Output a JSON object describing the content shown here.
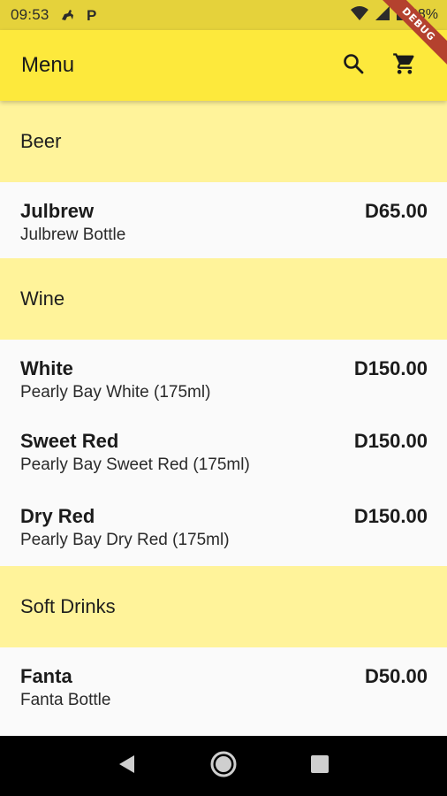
{
  "status_bar": {
    "time": "09:53",
    "battery": "68%"
  },
  "app_bar": {
    "title": "Menu",
    "search_icon": "search-icon",
    "cart_icon": "cart-icon",
    "color": "#fde93c"
  },
  "debug_banner": "DEBUG",
  "sections": [
    {
      "title": "Beer",
      "items": [
        {
          "name": "Julbrew",
          "description": "Julbrew Bottle",
          "price": "D65.00"
        }
      ]
    },
    {
      "title": "Wine",
      "items": [
        {
          "name": "White",
          "description": "Pearly Bay White (175ml)",
          "price": "D150.00"
        },
        {
          "name": "Sweet Red",
          "description": "Pearly Bay Sweet Red (175ml)",
          "price": "D150.00"
        },
        {
          "name": "Dry Red",
          "description": "Pearly Bay Dry Red (175ml)",
          "price": "D150.00"
        }
      ]
    },
    {
      "title": "Soft Drinks",
      "items": [
        {
          "name": "Fanta",
          "description": "Fanta Bottle",
          "price": "D50.00"
        }
      ]
    }
  ],
  "nav_bar": {
    "back": "back-icon",
    "home": "home-icon",
    "recents": "recents-icon"
  }
}
